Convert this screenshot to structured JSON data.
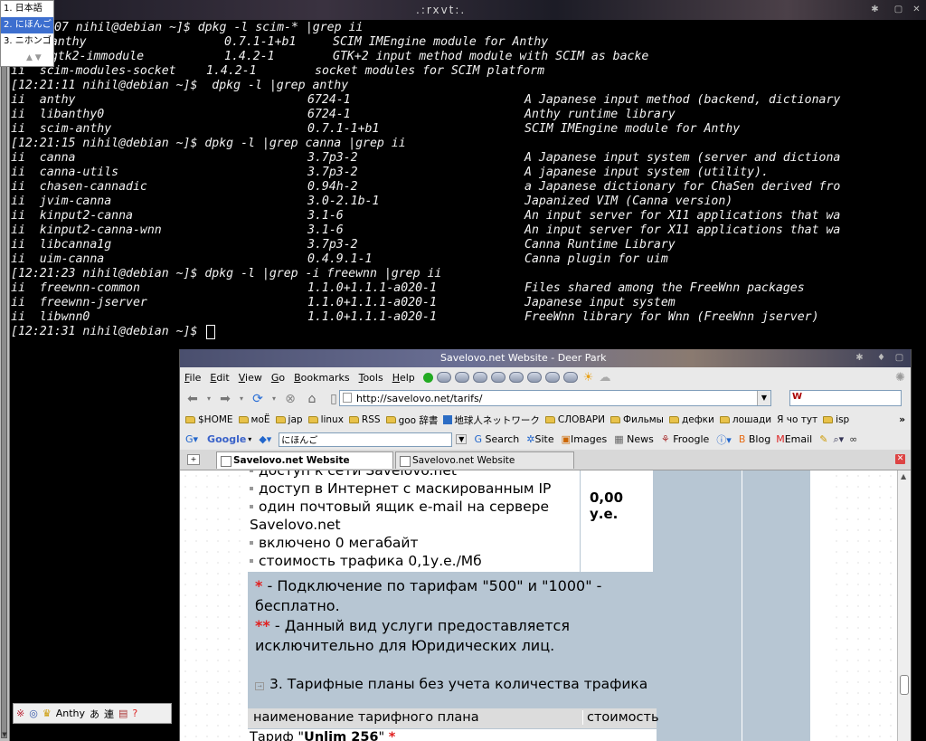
{
  "terminal": {
    "title": ".:rxvt:.",
    "lines": [
      {
        "c": [
          ":07 nihil@debian ~]$ dpkg -l scim-* |grep ii"
        ],
        "x": [
          0
        ]
      },
      {
        "c": [
          "im-anthy",
          "0.7.1-1+b1",
          "SCIM IMEngine module for Anthy"
        ],
        "x": [
          0,
          216,
          336
        ]
      },
      {
        "c": [
          "im-gtk2-immodule",
          "1.4.2-1",
          "GTK+2 input method module with SCIM as backe"
        ],
        "x": [
          0,
          216,
          336
        ]
      },
      {
        "c": [
          "ii  scim-modules-socket",
          "1.4.2-1",
          "socket modules for SCIM platform"
        ],
        "x": [
          0,
          216,
          336
        ]
      },
      {
        "c": [
          "[12:21:11 nihil@debian ~]$  dpkg -l |grep anthy"
        ],
        "x": [
          0
        ]
      },
      {
        "c": [
          "ii  anthy",
          "6724-1",
          "A Japanese input method (backend, dictionary"
        ],
        "x": [
          0,
          328,
          568
        ]
      },
      {
        "c": [
          "ii  libanthy0",
          "6724-1",
          "Anthy runtime library"
        ],
        "x": [
          0,
          328,
          568
        ]
      },
      {
        "c": [
          "ii  scim-anthy",
          "0.7.1-1+b1",
          "SCIM IMEngine module for Anthy"
        ],
        "x": [
          0,
          328,
          568
        ]
      },
      {
        "c": [
          "[12:21:15 nihil@debian ~]$ dpkg -l |grep canna |grep ii"
        ],
        "x": [
          0
        ]
      },
      {
        "c": [
          "ii  canna",
          "3.7p3-2",
          "A Japanese input system (server and dictiona"
        ],
        "x": [
          0,
          328,
          568
        ]
      },
      {
        "c": [
          "ii  canna-utils",
          "3.7p3-2",
          "A japanese input system (utility)."
        ],
        "x": [
          0,
          328,
          568
        ]
      },
      {
        "c": [
          "ii  chasen-cannadic",
          "0.94h-2",
          "a Japanese dictionary for ChaSen derived fro"
        ],
        "x": [
          0,
          328,
          568
        ]
      },
      {
        "c": [
          "ii  jvim-canna",
          "3.0-2.1b-1",
          "Japanized VIM (Canna version)"
        ],
        "x": [
          0,
          328,
          568
        ]
      },
      {
        "c": [
          "ii  kinput2-canna",
          "3.1-6",
          "An input server for X11 applications that wa"
        ],
        "x": [
          0,
          328,
          568
        ]
      },
      {
        "c": [
          "ii  kinput2-canna-wnn",
          "3.1-6",
          "An input server for X11 applications that wa"
        ],
        "x": [
          0,
          328,
          568
        ]
      },
      {
        "c": [
          "ii  libcanna1g",
          "3.7p3-2",
          "Canna Runtime Library"
        ],
        "x": [
          0,
          328,
          568
        ]
      },
      {
        "c": [
          "ii  uim-canna",
          "0.4.9.1-1",
          "Canna plugin for uim"
        ],
        "x": [
          0,
          328,
          568
        ]
      },
      {
        "c": [
          "[12:21:23 nihil@debian ~]$ dpkg -l |grep -i freewnn |grep ii"
        ],
        "x": [
          0
        ]
      },
      {
        "c": [
          "ii  freewnn-common",
          "1.1.0+1.1.1-a020-1",
          "Files shared among the FreeWnn packages"
        ],
        "x": [
          0,
          328,
          568
        ]
      },
      {
        "c": [
          "ii  freewnn-jserver",
          "1.1.0+1.1.1-a020-1",
          "Japanese input system"
        ],
        "x": [
          0,
          328,
          568
        ]
      },
      {
        "c": [
          "ii  libwnn0",
          "1.1.0+1.1.1-a020-1",
          "FreeWnn library for Wnn (FreeWnn jserver)"
        ],
        "x": [
          0,
          328,
          568
        ]
      },
      {
        "c": [
          "[12:21:31 nihil@debian ~]$"
        ],
        "x": [
          0
        ]
      }
    ]
  },
  "ime": {
    "candidates": [
      "1. 日本語",
      "2. にほんご",
      "3. ニホンゴ"
    ],
    "selected_index": 1,
    "toolbar_label": "Anthy",
    "toolbar_mode": "あ",
    "toolbar_conv": "連"
  },
  "browser": {
    "title": "Savelovo.net Website - Deer Park",
    "menu": [
      {
        "label": "File",
        "key": "F"
      },
      {
        "label": "Edit",
        "key": "E"
      },
      {
        "label": "View",
        "key": "V"
      },
      {
        "label": "Go",
        "key": "G"
      },
      {
        "label": "Bookmarks",
        "key": "B"
      },
      {
        "label": "Tools",
        "key": "T"
      },
      {
        "label": "Help",
        "key": "H"
      }
    ],
    "url": "http://savelovo.net/tarifs/",
    "search_engine_label": "W",
    "bookmarks": [
      "$HOME",
      "моЁ",
      "jap",
      "linux",
      "RSS",
      "goo 辞書",
      "地球人ネットワーク",
      "СЛОВАРИ",
      "Фильмы",
      "дефки",
      "лошади",
      "Я чо тут",
      "isp"
    ],
    "bookmark_more": "»",
    "google": {
      "label": "Google",
      "input_value": "にほんご",
      "buttons": [
        "Search",
        "Site",
        "Images",
        "News",
        "Froogle",
        "Blog",
        "Email"
      ]
    },
    "tabs": [
      "Savelovo.net Website",
      "Savelovo.net Website"
    ],
    "active_tab": 0
  },
  "page": {
    "features": [
      "доступ к сети Savelovo.net",
      "доступ в Интернет с маскированным IP",
      "один почтовый ящик e-mail на сервере",
      "Savelovo.net",
      "включено 0 мегабайт",
      "стоимость трафика 0,1у.е./Мб"
    ],
    "price": "0,00 у.е.",
    "note1_mark": "*",
    "note1": "- Подключение по тарифам \"500\" и \"1000\" - бесплатно.",
    "note2_mark": "**",
    "note2": "- Данный вид услуги предоставляется исключительно для Юридических лиц.",
    "section3": "3. Тарифные планы без учета количества трафика",
    "table_headers": [
      "наименование тарифного плана",
      "стоимость"
    ],
    "row1_prefix": "Тариф \"",
    "row1_name": "Unlim 256",
    "row1_suffix": "\" ",
    "row1_mark": "*"
  }
}
